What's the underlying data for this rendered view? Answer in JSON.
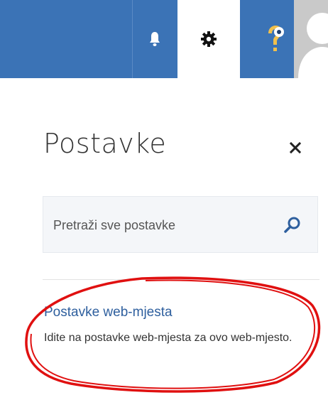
{
  "topbar": {
    "icons": [
      "bell-icon",
      "gear-icon",
      "help-icon",
      "avatar"
    ],
    "accent_color": "#3b73b6"
  },
  "panel": {
    "title": "Postavke",
    "close_icon": "close-icon",
    "search": {
      "placeholder": "Pretraži sve postavke",
      "icon": "search-icon"
    },
    "items": [
      {
        "title": "Postavke web-mjesta",
        "description": "Idite na postavke web-mjesta za ovo web-mjesto."
      }
    ]
  },
  "annotation": {
    "shape": "ellipse",
    "color": "#e01010"
  }
}
